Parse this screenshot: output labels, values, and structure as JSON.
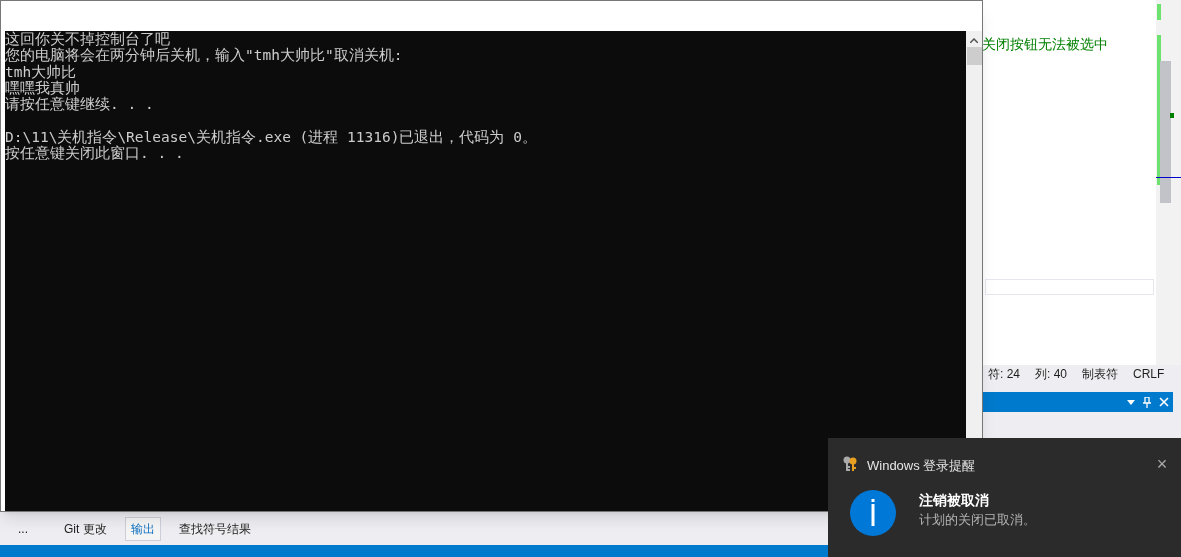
{
  "editor": {
    "comment_text": "关闭按钮无法被选中",
    "status": [
      "符: 24",
      "列: 40",
      "制表符",
      "CRLF"
    ]
  },
  "bottom_tabs": [
    {
      "label": "...",
      "selected": false
    },
    {
      "label": "Git 更改",
      "selected": false
    },
    {
      "label": "输出",
      "selected": true
    },
    {
      "label": "查找符号结果",
      "selected": false
    }
  ],
  "console": {
    "program_output": [
      "这回你关不掉控制台了吧",
      "您的电脑将会在两分钟后关机，输入\"tmh大帅比\"取消关机:",
      "tmh大帅比",
      "嘿嘿我真帅",
      "请按任意键继续. . ."
    ],
    "exit_message": [
      "D:\\11\\关机指令\\Release\\关机指令.exe (进程 11316)已退出，代码为 0。",
      "按任意键关闭此窗口. . ."
    ]
  },
  "toast": {
    "app": "Windows 登录提醒",
    "title": "注销被取消",
    "message": "计划的关闭已取消。",
    "close": "×"
  }
}
